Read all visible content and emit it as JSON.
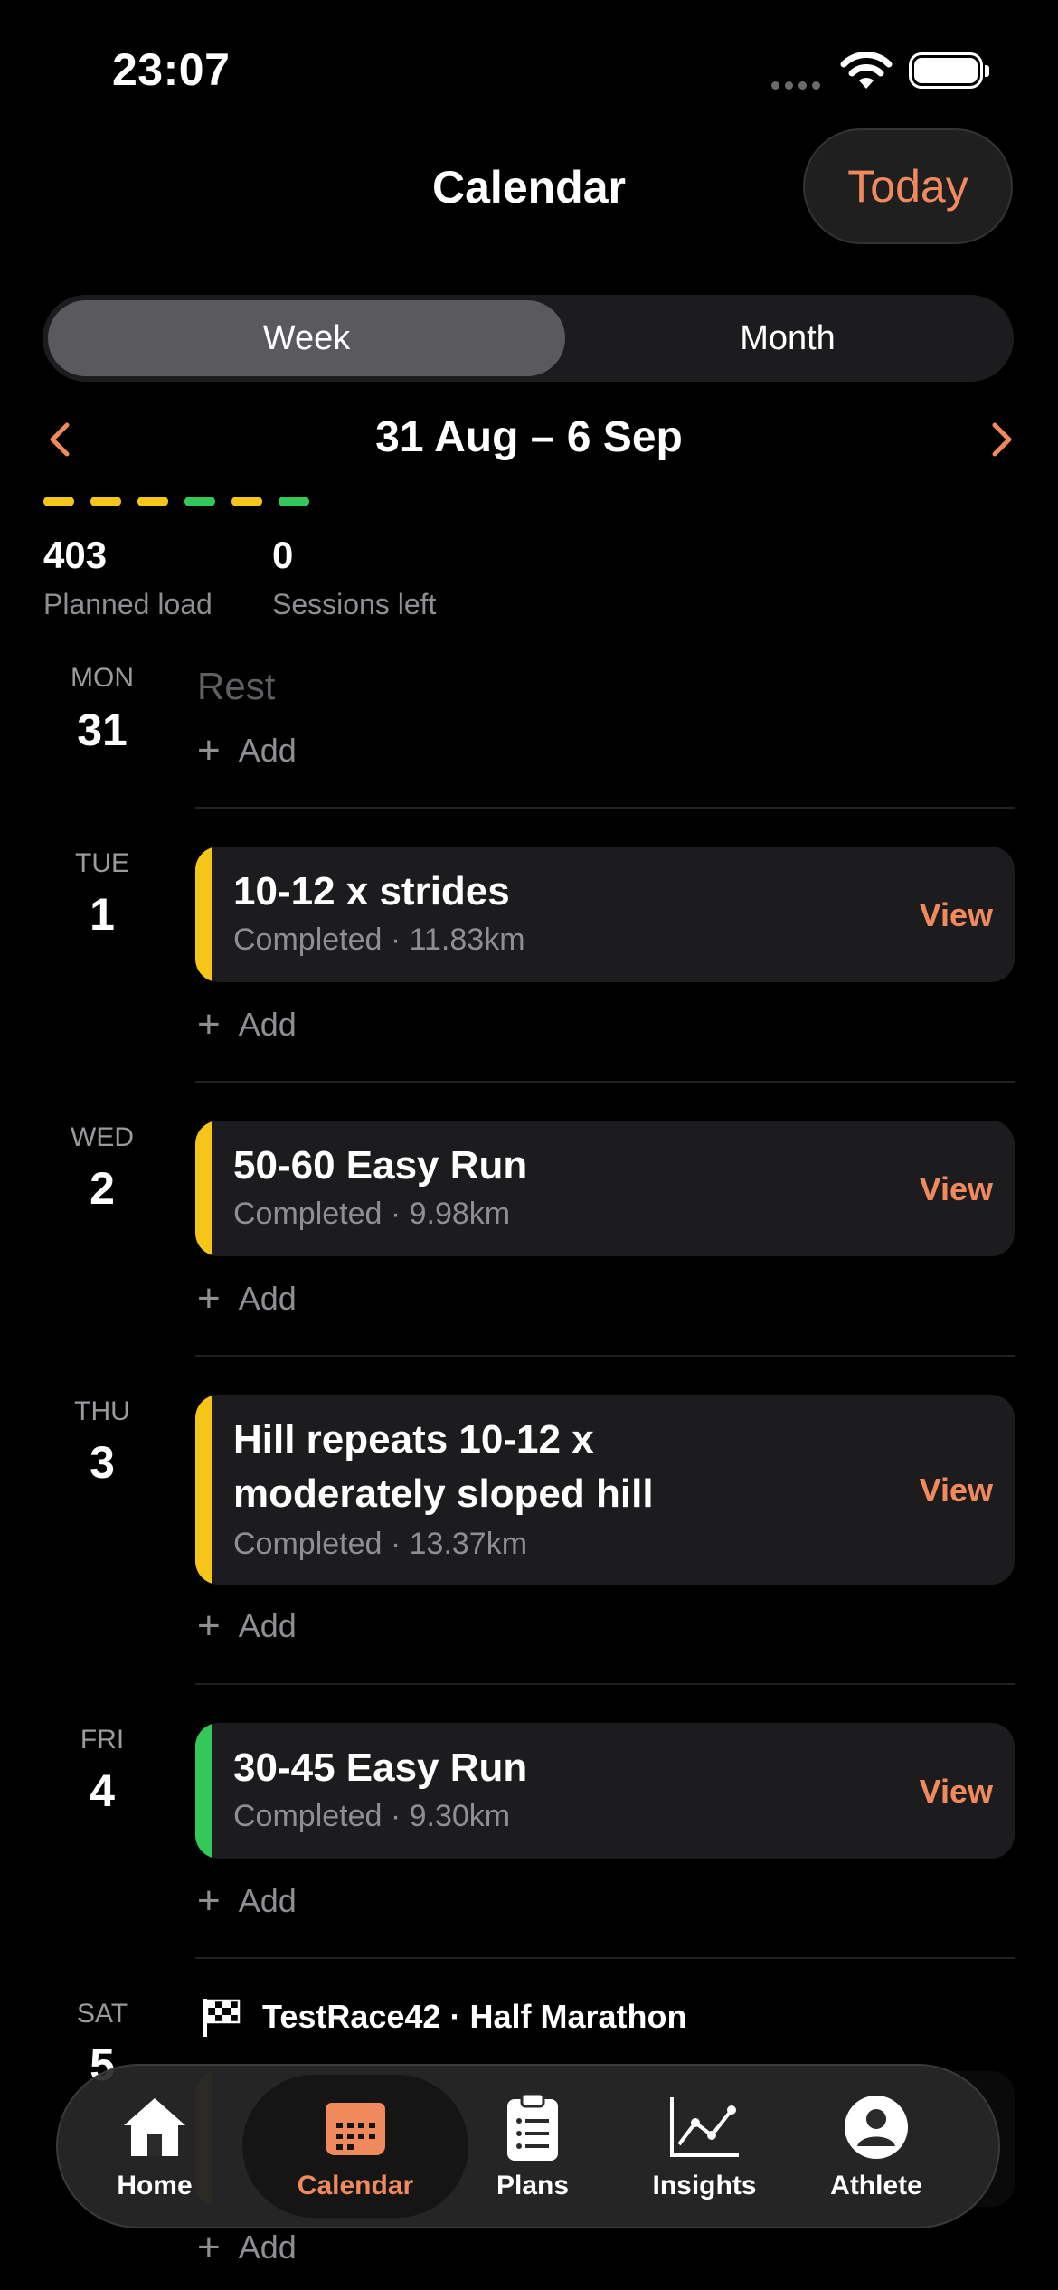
{
  "status": {
    "time": "23:07"
  },
  "header": {
    "title": "Calendar",
    "today_label": "Today"
  },
  "segment": {
    "week": "Week",
    "month": "Month",
    "selected": "Week"
  },
  "week": {
    "range": "31 Aug – 6 Sep",
    "load_colors": [
      "#f5c518",
      "#f5c518",
      "#f5c518",
      "#34c759",
      "#f5c518",
      "#34c759"
    ],
    "planned_load_value": "403",
    "planned_load_label": "Planned load",
    "sessions_left_value": "0",
    "sessions_left_label": "Sessions left"
  },
  "days": [
    {
      "dow": "MON",
      "num": "31",
      "rest": "Rest",
      "add": "Add"
    },
    {
      "dow": "TUE",
      "num": "1",
      "session_title": "10-12 x strides",
      "session_sub": "Completed · 11.83km",
      "view": "View",
      "color": "#f5c518",
      "add": "Add"
    },
    {
      "dow": "WED",
      "num": "2",
      "session_title": "50-60 Easy Run",
      "session_sub": "Completed · 9.98km",
      "view": "View",
      "color": "#f5c518",
      "add": "Add"
    },
    {
      "dow": "THU",
      "num": "3",
      "session_title": "Hill repeats 10-12 x moderately sloped hill",
      "session_sub": "Completed · 13.37km",
      "view": "View",
      "color": "#f5c518",
      "add": "Add"
    },
    {
      "dow": "FRI",
      "num": "4",
      "session_title": "30-45 Easy Run",
      "session_sub": "Completed · 9.30km",
      "view": "View",
      "color": "#34c759",
      "add": "Add"
    },
    {
      "dow": "SAT",
      "num": "5",
      "race": "TestRace42 · Half Marathon",
      "add": "Add"
    }
  ],
  "tabs": [
    {
      "label": "Home",
      "icon": "home-icon"
    },
    {
      "label": "Calendar",
      "icon": "calendar-icon",
      "active": true
    },
    {
      "label": "Plans",
      "icon": "clipboard-icon"
    },
    {
      "label": "Insights",
      "icon": "chart-icon"
    },
    {
      "label": "Athlete",
      "icon": "person-icon"
    }
  ],
  "colors": {
    "accent": "#f08a5d",
    "yellow": "#f5c518",
    "green": "#34c759"
  }
}
